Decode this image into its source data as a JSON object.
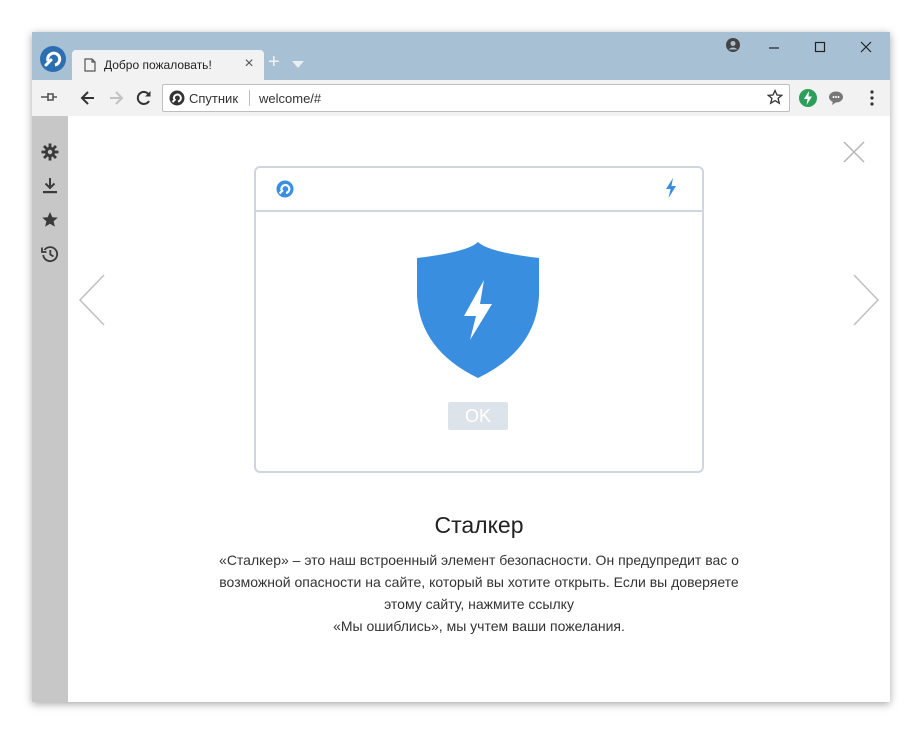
{
  "browser": {
    "tab": {
      "title": "Добро пожаловать!",
      "close_label": "×"
    },
    "new_tab_label": "+",
    "address_bar": {
      "site_name": "Спутник",
      "url": "welcome/#"
    }
  },
  "welcome_slide": {
    "dialog_button_label": "OK",
    "heading": "Сталкер",
    "description_lines": [
      "«Сталкер» – это наш встроенный элемент безопасности. Он предупредит вас о",
      "возможной опасности на сайте, который вы хотите открыть. Если вы доверяете",
      "этому сайту, нажмите ссылку",
      "«Мы ошиблись», мы учтем ваши пожелания."
    ]
  },
  "colors": {
    "titlebar": "#a7c0d4",
    "accent_blue": "#3a8ee0",
    "sidebar": "#c7c7c7",
    "extension_green": "#2e9e5b"
  },
  "icons": {
    "sidebar": [
      "settings-icon",
      "download-icon",
      "bookmark-star-icon",
      "history-icon"
    ],
    "toolbar": [
      "back-arrow-icon",
      "forward-arrow-icon",
      "reload-icon",
      "bookmark-star-icon",
      "lightning-extension-icon",
      "chat-extension-icon",
      "menu-kebab-icon"
    ]
  }
}
